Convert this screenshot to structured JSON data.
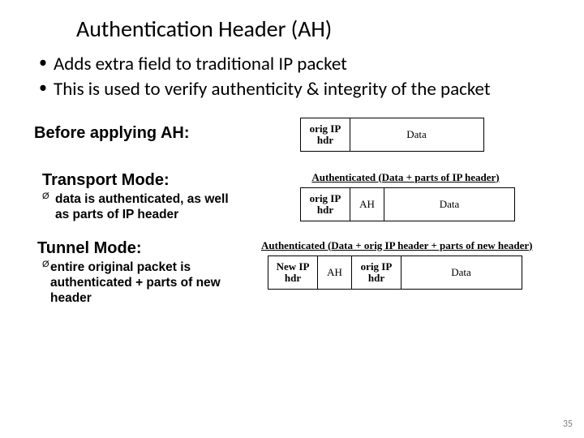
{
  "title": "Authentication Header (AH)",
  "bullets": [
    "Adds extra field to traditional IP packet",
    "This is used to verify authenticity & integrity of the packet"
  ],
  "before_label": "Before applying AH:",
  "transport": {
    "label": "Transport Mode:",
    "sub": "data is authenticated, as well as parts of IP header",
    "caption": "Authenticated (Data + parts of IP header)"
  },
  "tunnel": {
    "label": "Tunnel Mode:",
    "sub": "entire original packet is authenticated + parts of new header",
    "caption": "Authenticated (Data + orig IP header + parts of new header)"
  },
  "cells": {
    "orig_ip_hdr": "orig IP\nhdr",
    "data": "Data",
    "ah": "AH",
    "new_ip_hdr": "New IP\nhdr"
  },
  "slidenum": "35"
}
